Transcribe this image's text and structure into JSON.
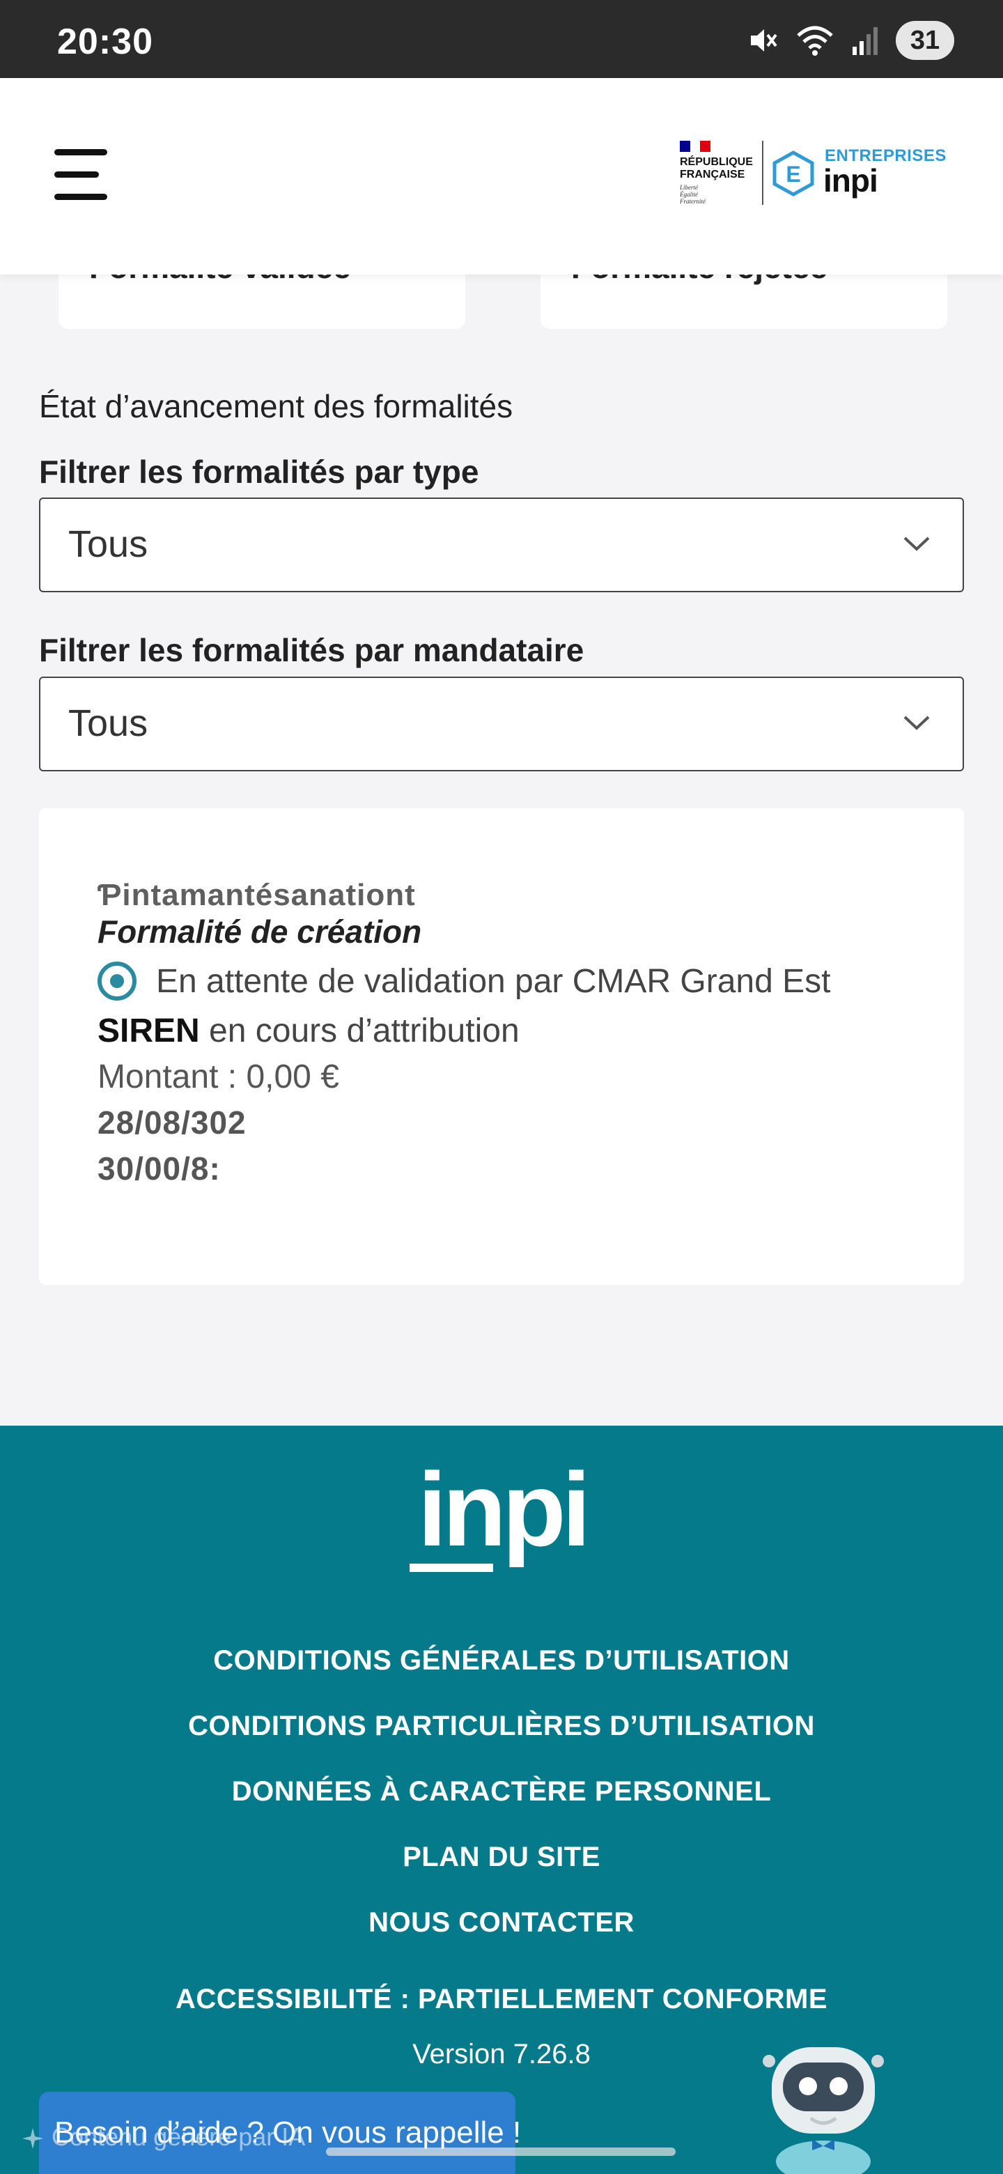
{
  "status_bar": {
    "time": "20:30",
    "battery": "31",
    "icons": [
      "mute-icon",
      "wifi-icon",
      "signal-icon"
    ]
  },
  "header": {
    "republic_line1": "RÉPUBLIQUE",
    "republic_line2": "FRANÇAISE",
    "motto": [
      "Liberté",
      "Égalité",
      "Fraternité"
    ],
    "brand_top": "ENTREPRISES",
    "brand_main": "inpi",
    "e_letter": "E"
  },
  "status_cards": {
    "left_label": "Formalité validée",
    "right_label": "Formalité rejetée"
  },
  "section": {
    "title": "État d’avancement des formalités"
  },
  "filters": {
    "type_label": "Filtrer les formalités par type",
    "type_value": "Tous",
    "mandataire_label": "Filtrer les formalités par mandataire",
    "mandataire_value": "Tous"
  },
  "formalite": {
    "name": "Ƥintamantésanationt",
    "type": "Formalité de création",
    "state": "En attente de validation par CMAR Grand Est",
    "siren_label": "SIREN",
    "siren_value": " en cours d’attribution",
    "amount": "Montant : 0,00 €",
    "date1": "28/08/302",
    "date2": "30/00/8:"
  },
  "footer": {
    "logo_text": "inpi",
    "links": [
      "CONDITIONS GÉNÉRALES D’UTILISATION",
      "CONDITIONS PARTICULIÈRES D’UTILISATION",
      "DONNÉES À CARACTÈRE PERSONNEL",
      "PLAN DU SITE",
      "NOUS CONTACTER"
    ],
    "accessibility": "ACCESSIBILITÉ : PARTIELLEMENT CONFORME",
    "version": "Version 7.26.8"
  },
  "help": {
    "button": "Besoin d’aide ? On vous rappelle !",
    "ai_note": "Contenu généré par IA"
  },
  "colors": {
    "footer_bg": "#047a8a",
    "accent": "#2a8ba0",
    "help_btn": "#2f7fd0"
  }
}
